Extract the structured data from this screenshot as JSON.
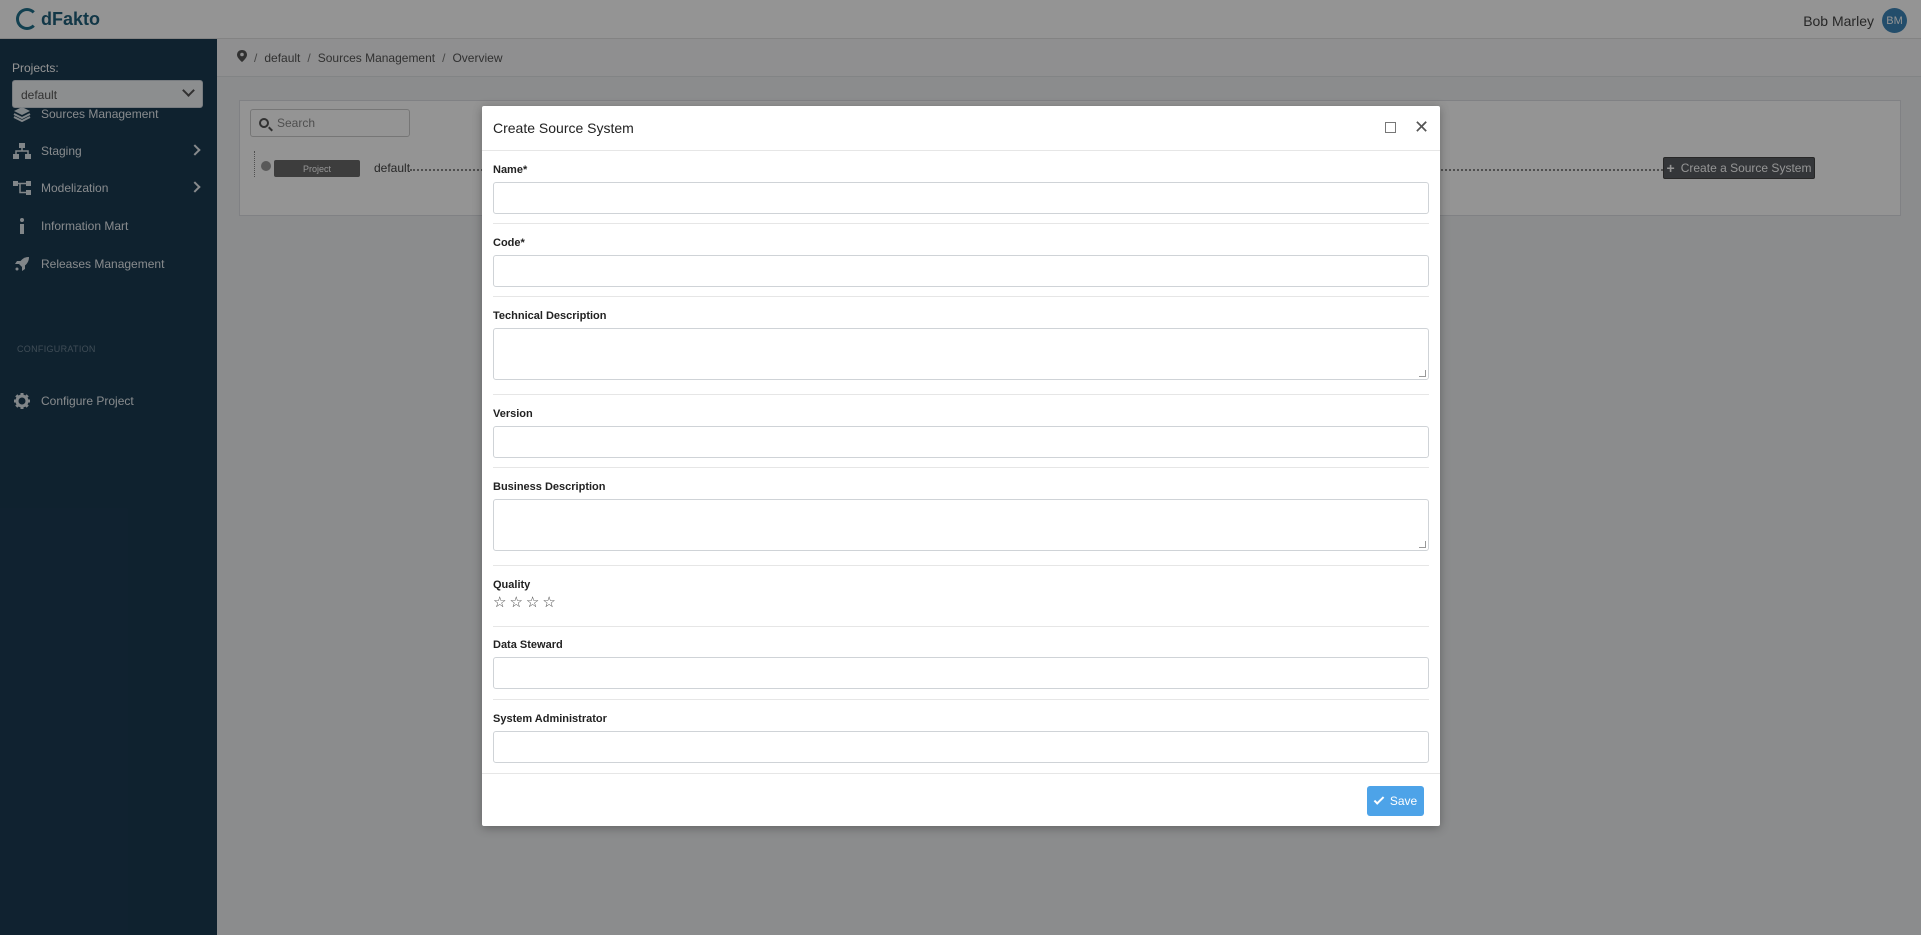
{
  "app": {
    "logo_text": "dFakto"
  },
  "user": {
    "name": "Bob Marley",
    "initials": "BM"
  },
  "sidebar": {
    "projects_label": "Projects:",
    "project_selected": "default",
    "items": [
      {
        "label": "Sources Management",
        "icon": "layers-icon"
      },
      {
        "label": "Staging",
        "icon": "sitemap-icon"
      },
      {
        "label": "Modelization",
        "icon": "diagram-icon"
      },
      {
        "label": "Information Mart",
        "icon": "info-icon"
      },
      {
        "label": "Releases Management",
        "icon": "rocket-icon"
      }
    ],
    "section_label": "CONFIGURATION",
    "config_item": {
      "label": "Configure Project",
      "icon": "gear-icon"
    }
  },
  "breadcrumb": {
    "items": [
      "default",
      "Sources Management",
      "Overview"
    ]
  },
  "main": {
    "search_placeholder": "Search",
    "tree_badge": "Project",
    "tree_node": "default",
    "create_button": "Create a Source System"
  },
  "modal": {
    "title": "Create Source System",
    "fields": {
      "name": {
        "label": "Name*",
        "value": ""
      },
      "code": {
        "label": "Code*",
        "value": ""
      },
      "technical_description": {
        "label": "Technical Description",
        "value": ""
      },
      "version": {
        "label": "Version",
        "value": ""
      },
      "business_description": {
        "label": "Business Description",
        "value": ""
      },
      "quality": {
        "label": "Quality",
        "stars": 0,
        "max": 4
      },
      "data_steward": {
        "label": "Data Steward",
        "value": ""
      },
      "system_administrator": {
        "label": "System Administrator",
        "value": ""
      }
    },
    "save_label": "Save"
  },
  "colors": {
    "sidebar_bg": "#1b3b52",
    "save_button": "#4da3e8",
    "avatar": "#3d86b8"
  }
}
